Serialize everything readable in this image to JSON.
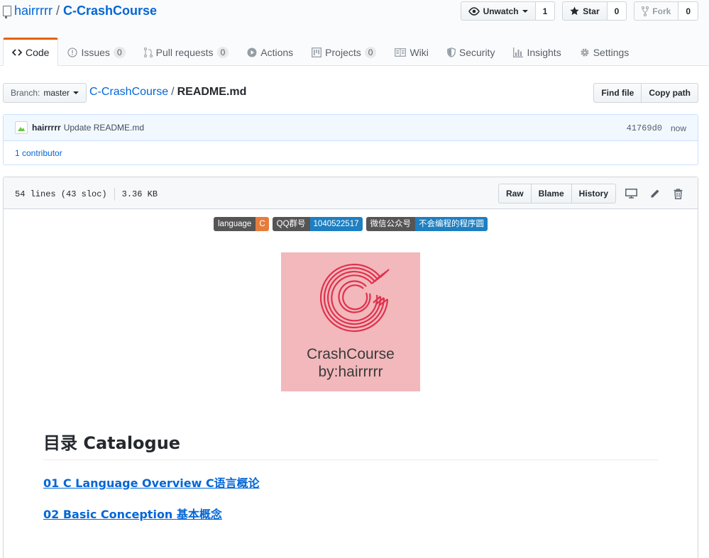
{
  "repo": {
    "owner": "hairrrrr",
    "name": "C-CrashCourse"
  },
  "actions": {
    "watch": {
      "label": "Unwatch",
      "count": "1"
    },
    "star": {
      "label": "Star",
      "count": "0"
    },
    "fork": {
      "label": "Fork",
      "count": "0"
    }
  },
  "tabs": [
    {
      "label": "Code"
    },
    {
      "label": "Issues",
      "count": "0"
    },
    {
      "label": "Pull requests",
      "count": "0"
    },
    {
      "label": "Actions"
    },
    {
      "label": "Projects",
      "count": "0"
    },
    {
      "label": "Wiki"
    },
    {
      "label": "Security"
    },
    {
      "label": "Insights"
    },
    {
      "label": "Settings"
    }
  ],
  "file_nav": {
    "branch_prefix": "Branch:",
    "branch": "master",
    "breadcrumb_repo": "C-CrashCourse",
    "breadcrumb_file": "README.md",
    "find_file": "Find file",
    "copy_path": "Copy path"
  },
  "commit": {
    "author": "hairrrrr",
    "message": "Update README.md",
    "sha": "41769d0",
    "time": "now",
    "contributors": "1 contributor"
  },
  "file": {
    "lines": "54 lines (43 sloc)",
    "size": "3.36 KB",
    "raw": "Raw",
    "blame": "Blame",
    "history": "History"
  },
  "readme": {
    "badges": [
      {
        "left": "language",
        "right": "C",
        "color": "#e67c3c"
      },
      {
        "left": "QQ群号",
        "right": "1040522517",
        "color": "#1e7fc1"
      },
      {
        "left": "微信公众号",
        "right": "不会编程的程序圆",
        "color": "#1e7fc1"
      }
    ],
    "logo_line1": "CrashCourse",
    "logo_line2": "by:hairrrrr",
    "heading": "目录 Catalogue",
    "toc": [
      "01 C Language Overview C语言概论",
      "02 Basic Conception 基本概念"
    ]
  },
  "colors": {
    "link": "#0366d6",
    "tab_accent": "#e36209",
    "logo_bg": "#f2b8bc",
    "logo_mark": "#e0314d"
  }
}
